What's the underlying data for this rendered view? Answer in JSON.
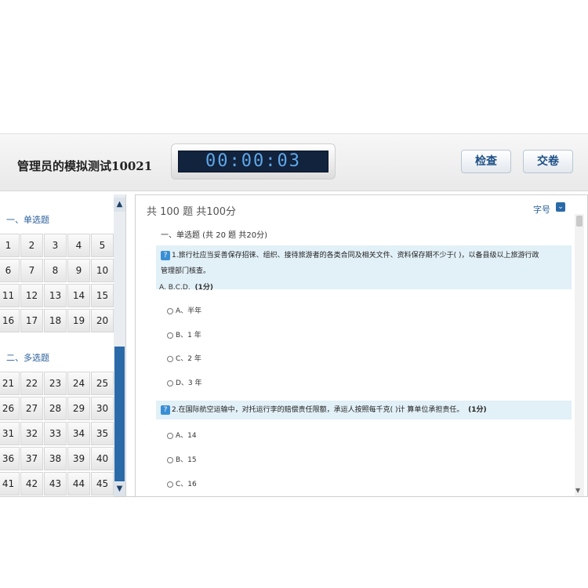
{
  "header": {
    "title": "管理员的模拟测试10021",
    "timer": "00:00:03",
    "check_label": "检查",
    "submit_label": "交卷"
  },
  "sidebar": {
    "sections": [
      {
        "label": "一、单选题",
        "numbers": [
          "1",
          "2",
          "3",
          "4",
          "5",
          "6",
          "7",
          "8",
          "9",
          "10",
          "11",
          "12",
          "13",
          "14",
          "15",
          "16",
          "17",
          "18",
          "19",
          "20"
        ]
      },
      {
        "label": "二、多选题",
        "numbers": [
          "21",
          "22",
          "23",
          "24",
          "25",
          "26",
          "27",
          "28",
          "29",
          "30",
          "31",
          "32",
          "33",
          "34",
          "35",
          "36",
          "37",
          "38",
          "39",
          "40",
          "41",
          "42",
          "43",
          "44",
          "45"
        ]
      }
    ]
  },
  "main": {
    "total": "共 100 题 共100分",
    "font_label": "字号",
    "section_head": "一、单选题 (共 20 题 共20分)",
    "questions": [
      {
        "text_line1": "1.旅行社应当妥善保存招徕、组织、接待旅游者的各类合同及相关文件、资料保存期不少于( )，以备县级以上旅游行政",
        "text_line2": "管理部门核查。",
        "answer": "A. B.C.D.",
        "score": "(1分)",
        "options": [
          "A、半年",
          "B、1 年",
          "C、2 年",
          "D、3 年"
        ]
      },
      {
        "text_line1": "2.在国际航空运输中，对托运行李的赔偿责任限额，承运人按照每千克( )计 算单位承担责任。",
        "score": "(1分)",
        "options": [
          "A、14",
          "B、15",
          "C、16"
        ]
      }
    ]
  },
  "icons": {
    "scroll_up": "chevron-up-icon",
    "scroll_down": "chevron-down-icon",
    "question": "question-mark-icon",
    "font_toggle": "chevron-down-icon"
  },
  "colors": {
    "accent": "#2b6aa8",
    "timer_bg": "#12233d",
    "timer_text": "#5fa8e8",
    "question_bg": "#e2f0f7"
  }
}
